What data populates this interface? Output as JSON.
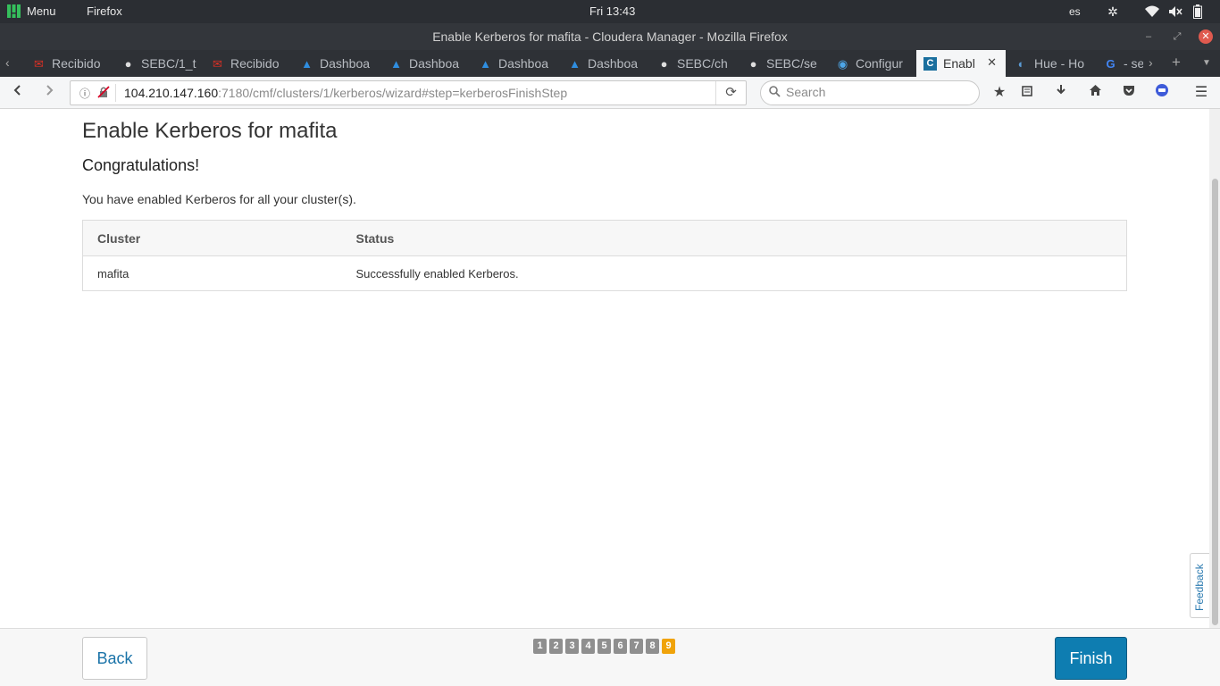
{
  "panel": {
    "menu_label": "Menu",
    "app_label": "Firefox",
    "clock": "Fri 13:43",
    "lang": "es"
  },
  "window": {
    "title": "Enable Kerberos for mafita - Cloudera Manager - Mozilla Firefox"
  },
  "tabs": [
    {
      "label": "Recibido",
      "icon": "gmail-icon",
      "active": false
    },
    {
      "label": "SEBC/1_t",
      "icon": "github-icon",
      "active": false
    },
    {
      "label": "Recibido",
      "icon": "gmail-icon",
      "active": false
    },
    {
      "label": "Dashboa",
      "icon": "azure-icon",
      "active": false
    },
    {
      "label": "Dashboa",
      "icon": "azure-icon",
      "active": false
    },
    {
      "label": "Dashboa",
      "icon": "azure-icon",
      "active": false
    },
    {
      "label": "Dashboa",
      "icon": "azure-icon",
      "active": false
    },
    {
      "label": "SEBC/ch",
      "icon": "github-icon",
      "active": false
    },
    {
      "label": "SEBC/se",
      "icon": "github-icon",
      "active": false
    },
    {
      "label": "Configur",
      "icon": "cloudera-icon",
      "active": false
    },
    {
      "label": "Enabl",
      "icon": "cloudera-c-icon",
      "active": true
    },
    {
      "label": "Hue - Ho",
      "icon": "hue-icon",
      "active": false
    },
    {
      "label": "- se",
      "icon": "google-icon",
      "active": false
    }
  ],
  "navbar": {
    "url_host": "104.210.147.160",
    "url_rest": ":7180/cmf/clusters/1/kerberos/wizard#step=kerberosFinishStep",
    "search_placeholder": "Search"
  },
  "content": {
    "heading": "Enable Kerberos for mafita",
    "subheading": "Congratulations!",
    "description": "You have enabled Kerberos for all your cluster(s).",
    "table": {
      "headers": [
        "Cluster",
        "Status"
      ],
      "rows": [
        [
          "mafita",
          "Successfully enabled Kerberos."
        ]
      ]
    },
    "feedback_label": "Feedback"
  },
  "footer": {
    "back_label": "Back",
    "finish_label": "Finish",
    "steps": [
      "1",
      "2",
      "3",
      "4",
      "5",
      "6",
      "7",
      "8",
      "9"
    ],
    "current_step": "9"
  },
  "colors": {
    "primary_button": "#0e7db1",
    "current_step": "#f0a30a",
    "link": "#1a73a8"
  }
}
